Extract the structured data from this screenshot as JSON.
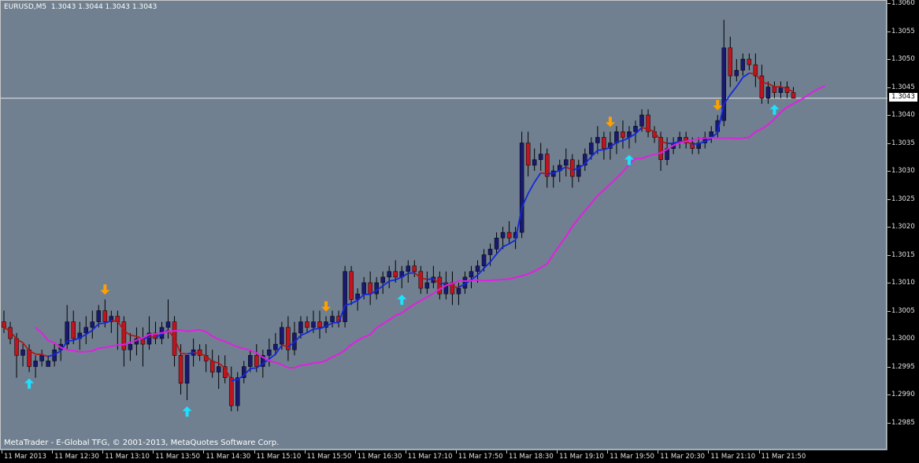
{
  "window": {
    "title": "EURUSD,M5  1.3043 1.3044 1.3043 1.3043",
    "footer": "MetaTrader - E-Global TFG, © 2001-2013, MetaQuotes Software Corp.",
    "current_price": "1.3043"
  },
  "colors": {
    "background": "#708090",
    "bull_candle": "#191970",
    "bear_candle": "#c0141e",
    "wick": "#000000",
    "blue_line": "#1428dc",
    "red_line": "#b01818",
    "magenta_line": "#e020e0",
    "up_arrow": "#20e0ff",
    "down_arrow": "#ffa000",
    "bid_line": "#e8e8e8"
  },
  "price_axis": [
    "1.3060",
    "1.3055",
    "1.3050",
    "1.3045",
    "1.3040",
    "1.3035",
    "1.3030",
    "1.3025",
    "1.3020",
    "1.3015",
    "1.3010",
    "1.3005",
    "1.3000",
    "1.2995",
    "1.2990",
    "1.2985"
  ],
  "time_axis": [
    "11 Mar 2013",
    "11 Mar 12:30",
    "11 Mar 13:10",
    "11 Mar 13:50",
    "11 Mar 14:30",
    "11 Mar 15:10",
    "11 Mar 15:50",
    "11 Mar 16:30",
    "11 Mar 17:10",
    "11 Mar 17:50",
    "11 Mar 18:30",
    "11 Mar 19:10",
    "11 Mar 19:50",
    "11 Mar 20:30",
    "11 Mar 21:10",
    "11 Mar 21:50"
  ],
  "chart_data": {
    "type": "candlestick",
    "symbol": "EURUSD",
    "timeframe": "M5",
    "ylim": [
      1.2984,
      1.3061
    ],
    "bid": 1.3043,
    "candles": [
      [
        1.3003,
        1.3005,
        1.3001,
        1.3002
      ],
      [
        1.3002,
        1.3003,
        1.2999,
        1.3
      ],
      [
        1.3,
        1.3001,
        1.2993,
        1.2997
      ],
      [
        1.2997,
        1.2999,
        1.2995,
        1.2998
      ],
      [
        1.2998,
        1.2999,
        1.2994,
        1.2995
      ],
      [
        1.2995,
        1.2997,
        1.2993,
        1.2996
      ],
      [
        1.2996,
        1.2998,
        1.2995,
        1.2997
      ],
      [
        1.2995,
        1.2997,
        1.2995,
        1.2996
      ],
      [
        1.2996,
        1.2999,
        1.2995,
        1.2998
      ],
      [
        1.2998,
        1.3,
        1.2996,
        1.2999
      ],
      [
        1.2999,
        1.3006,
        1.2998,
        1.3003
      ],
      [
        1.3003,
        1.3005,
        1.2999,
        1.3
      ],
      [
        1.3,
        1.3003,
        1.2998,
        1.3001
      ],
      [
        1.3001,
        1.3004,
        1.2999,
        1.3002
      ],
      [
        1.3002,
        1.3005,
        1.3,
        1.3003
      ],
      [
        1.3003,
        1.3006,
        1.3002,
        1.3005
      ],
      [
        1.3005,
        1.3007,
        1.3002,
        1.3003
      ],
      [
        1.3003,
        1.3005,
        1.3001,
        1.3004
      ],
      [
        1.3004,
        1.3005,
        1.2998,
        1.3003
      ],
      [
        1.3003,
        1.3004,
        1.2995,
        1.2998
      ],
      [
        1.2998,
        1.3001,
        1.2996,
        1.2999
      ],
      [
        1.2999,
        1.3002,
        1.2997,
        1.3
      ],
      [
        1.3,
        1.3002,
        1.2995,
        1.2999
      ],
      [
        1.2999,
        1.3004,
        1.2998,
        1.3001
      ],
      [
        1.3001,
        1.3003,
        1.2999,
        1.3
      ],
      [
        1.3,
        1.3003,
        1.2999,
        1.3002
      ],
      [
        1.3002,
        1.3007,
        1.3,
        1.3003
      ],
      [
        1.3003,
        1.3004,
        1.2995,
        1.2997
      ],
      [
        1.2997,
        1.2999,
        1.299,
        1.2992
      ],
      [
        1.2992,
        1.2997,
        1.2989,
        1.2997
      ],
      [
        1.2997,
        1.3,
        1.2995,
        1.2998
      ],
      [
        1.2998,
        1.2999,
        1.2996,
        1.2997
      ],
      [
        1.2997,
        1.2999,
        1.2994,
        1.2996
      ],
      [
        1.2996,
        1.2998,
        1.2993,
        1.2994
      ],
      [
        1.2994,
        1.2997,
        1.2991,
        1.2995
      ],
      [
        1.2995,
        1.2997,
        1.2992,
        1.2993
      ],
      [
        1.2993,
        1.2995,
        1.2987,
        1.2988
      ],
      [
        1.2988,
        1.2994,
        1.2987,
        1.2993
      ],
      [
        1.2993,
        1.2996,
        1.2992,
        1.2995
      ],
      [
        1.2995,
        1.2998,
        1.2994,
        1.2997
      ],
      [
        1.2997,
        1.2999,
        1.2994,
        1.2995
      ],
      [
        1.2995,
        1.2998,
        1.2993,
        1.2997
      ],
      [
        1.2997,
        1.3,
        1.2995,
        1.2998
      ],
      [
        1.2998,
        1.3001,
        1.2997,
        1.2999
      ],
      [
        1.2999,
        1.3003,
        1.2998,
        1.3002
      ],
      [
        1.3002,
        1.3004,
        1.2996,
        1.2998
      ],
      [
        1.2998,
        1.3003,
        1.2997,
        1.3001
      ],
      [
        1.3001,
        1.3004,
        1.3,
        1.3003
      ],
      [
        1.3003,
        1.3004,
        1.3001,
        1.3002
      ],
      [
        1.3002,
        1.3005,
        1.3001,
        1.3003
      ],
      [
        1.3003,
        1.3005,
        1.3,
        1.3002
      ],
      [
        1.3002,
        1.3004,
        1.3001,
        1.3003
      ],
      [
        1.3003,
        1.3005,
        1.3002,
        1.3004
      ],
      [
        1.3004,
        1.3005,
        1.3002,
        1.3003
      ],
      [
        1.3003,
        1.3013,
        1.3002,
        1.3012
      ],
      [
        1.3012,
        1.3013,
        1.3006,
        1.3007
      ],
      [
        1.3007,
        1.3009,
        1.3005,
        1.3008
      ],
      [
        1.3008,
        1.3011,
        1.3007,
        1.301
      ],
      [
        1.301,
        1.3012,
        1.3006,
        1.3008
      ],
      [
        1.3008,
        1.3011,
        1.3007,
        1.301
      ],
      [
        1.301,
        1.3012,
        1.3008,
        1.3011
      ],
      [
        1.3011,
        1.3013,
        1.3009,
        1.3012
      ],
      [
        1.3012,
        1.3014,
        1.301,
        1.3011
      ],
      [
        1.3011,
        1.3013,
        1.3009,
        1.3012
      ],
      [
        1.3012,
        1.3014,
        1.301,
        1.3013
      ],
      [
        1.3013,
        1.3014,
        1.3011,
        1.3012
      ],
      [
        1.3012,
        1.3013,
        1.3008,
        1.3009
      ],
      [
        1.3009,
        1.3012,
        1.3008,
        1.301
      ],
      [
        1.301,
        1.3013,
        1.3009,
        1.3011
      ],
      [
        1.3011,
        1.3012,
        1.3007,
        1.3008
      ],
      [
        1.3008,
        1.3012,
        1.3007,
        1.301
      ],
      [
        1.301,
        1.3012,
        1.3006,
        1.3008
      ],
      [
        1.3008,
        1.301,
        1.3006,
        1.3009
      ],
      [
        1.3009,
        1.3012,
        1.3008,
        1.3011
      ],
      [
        1.3011,
        1.3013,
        1.3009,
        1.3012
      ],
      [
        1.3012,
        1.3014,
        1.301,
        1.3013
      ],
      [
        1.3013,
        1.3016,
        1.3012,
        1.3015
      ],
      [
        1.3015,
        1.3017,
        1.3013,
        1.3016
      ],
      [
        1.3016,
        1.3019,
        1.3015,
        1.3018
      ],
      [
        1.3018,
        1.302,
        1.3016,
        1.3019
      ],
      [
        1.3019,
        1.3021,
        1.3017,
        1.3018
      ],
      [
        1.3018,
        1.302,
        1.3016,
        1.3019
      ],
      [
        1.3019,
        1.3037,
        1.3018,
        1.3035
      ],
      [
        1.3035,
        1.3037,
        1.3029,
        1.3031
      ],
      [
        1.3031,
        1.3034,
        1.303,
        1.3032
      ],
      [
        1.3032,
        1.3035,
        1.303,
        1.3033
      ],
      [
        1.3033,
        1.3034,
        1.3027,
        1.3029
      ],
      [
        1.3029,
        1.3031,
        1.3027,
        1.303
      ],
      [
        1.303,
        1.3032,
        1.3028,
        1.3031
      ],
      [
        1.3031,
        1.3034,
        1.3029,
        1.3032
      ],
      [
        1.3032,
        1.3033,
        1.3027,
        1.3029
      ],
      [
        1.3029,
        1.3032,
        1.3028,
        1.3031
      ],
      [
        1.3031,
        1.3034,
        1.303,
        1.3033
      ],
      [
        1.3033,
        1.3036,
        1.3032,
        1.3035
      ],
      [
        1.3035,
        1.3038,
        1.3033,
        1.3036
      ],
      [
        1.3036,
        1.3037,
        1.3032,
        1.3034
      ],
      [
        1.3034,
        1.3037,
        1.3032,
        1.3035
      ],
      [
        1.3035,
        1.3038,
        1.3033,
        1.3037
      ],
      [
        1.3037,
        1.3039,
        1.3034,
        1.3036
      ],
      [
        1.3036,
        1.3038,
        1.3034,
        1.3037
      ],
      [
        1.3037,
        1.3039,
        1.3035,
        1.3038
      ],
      [
        1.3038,
        1.3041,
        1.3037,
        1.304
      ],
      [
        1.304,
        1.3041,
        1.3036,
        1.3037
      ],
      [
        1.3037,
        1.3038,
        1.3035,
        1.3036
      ],
      [
        1.3036,
        1.3037,
        1.303,
        1.3032
      ],
      [
        1.3032,
        1.3036,
        1.3031,
        1.3034
      ],
      [
        1.3034,
        1.3036,
        1.3033,
        1.3035
      ],
      [
        1.3035,
        1.3037,
        1.3034,
        1.3036
      ],
      [
        1.3036,
        1.3037,
        1.3034,
        1.3035
      ],
      [
        1.3035,
        1.3036,
        1.3033,
        1.3034
      ],
      [
        1.3034,
        1.3036,
        1.3033,
        1.3035
      ],
      [
        1.3035,
        1.3037,
        1.3034,
        1.3036
      ],
      [
        1.3036,
        1.3038,
        1.3035,
        1.3037
      ],
      [
        1.3037,
        1.304,
        1.3036,
        1.3039
      ],
      [
        1.3039,
        1.3057,
        1.3038,
        1.3052
      ],
      [
        1.3052,
        1.3054,
        1.3045,
        1.3047
      ],
      [
        1.3047,
        1.305,
        1.3046,
        1.3048
      ],
      [
        1.3048,
        1.3051,
        1.3047,
        1.305
      ],
      [
        1.305,
        1.3051,
        1.3048,
        1.3049
      ],
      [
        1.3049,
        1.3051,
        1.3045,
        1.3047
      ],
      [
        1.3047,
        1.3049,
        1.3042,
        1.3043
      ],
      [
        1.3043,
        1.3046,
        1.3042,
        1.3045
      ],
      [
        1.3045,
        1.3046,
        1.3043,
        1.3044
      ],
      [
        1.3044,
        1.3046,
        1.3043,
        1.3045
      ],
      [
        1.3045,
        1.3046,
        1.3043,
        1.3044
      ],
      [
        1.3044,
        1.3045,
        1.3043,
        1.3043
      ]
    ]
  }
}
